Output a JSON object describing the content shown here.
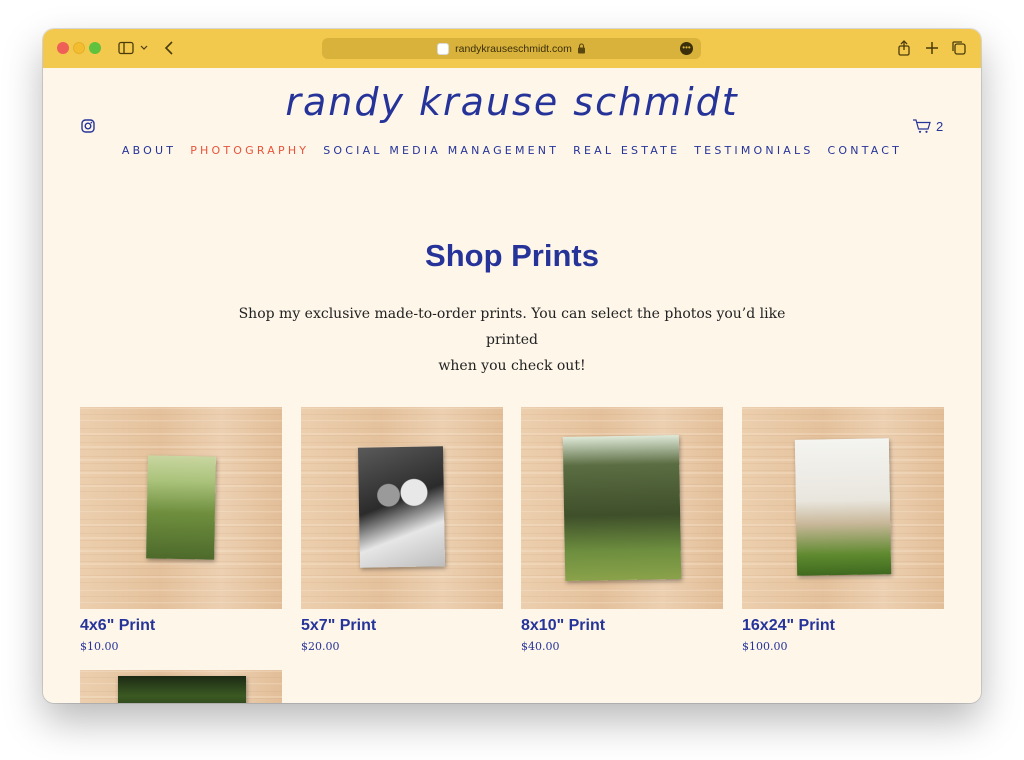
{
  "browser": {
    "url": "randykrauseschmidt.com",
    "more_label": "•••"
  },
  "site": {
    "logo": "randy krause schmidt",
    "cart_count": "2"
  },
  "nav": [
    {
      "label": "ABOUT",
      "active": false
    },
    {
      "label": "PHOTOGRAPHY",
      "active": true
    },
    {
      "label": "SOCIAL MEDIA MANAGEMENT",
      "active": false
    },
    {
      "label": "REAL ESTATE",
      "active": false
    },
    {
      "label": "TESTIMONIALS",
      "active": false
    },
    {
      "label": "CONTACT",
      "active": false
    }
  ],
  "main": {
    "title": "Shop Prints",
    "intro_line1": "Shop my exclusive made-to-order prints. You can select the photos you’d like printed",
    "intro_line2": "when you check out!"
  },
  "products": [
    {
      "title": "4x6\" Print",
      "price": "$10.00"
    },
    {
      "title": "5x7\" Print",
      "price": "$20.00"
    },
    {
      "title": "8x10\" Print",
      "price": "$40.00"
    },
    {
      "title": "16x24\" Print",
      "price": "$100.00"
    }
  ],
  "colors": {
    "toolbar": "#f2c94c",
    "page_bg": "#fdf6e9",
    "brand_blue": "#26349a",
    "active_nav": "#e8543a"
  },
  "icons": [
    "sidebar-icon",
    "chevron-down-icon",
    "back-icon",
    "lock-icon",
    "more-icon",
    "share-icon",
    "plus-icon",
    "tabs-icon",
    "instagram-icon",
    "cart-icon"
  ]
}
